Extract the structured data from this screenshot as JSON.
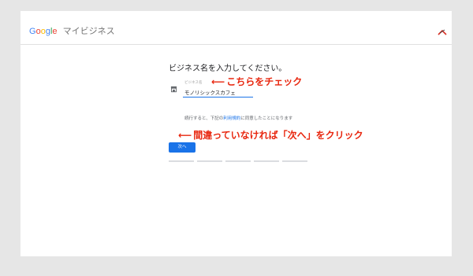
{
  "header": {
    "brand_google": "Google",
    "product": "マイビジネス"
  },
  "main": {
    "heading": "ビジネス名を入力してください。",
    "field": {
      "label": "ビジネス名",
      "value": "モノリシックスカフェ"
    },
    "terms": {
      "before": "続行すると、下記の",
      "link": "利用規約",
      "after": "に同意したことになります"
    },
    "next_label": "次へ",
    "progress_steps": 5
  },
  "annotations": {
    "callout1": "こちらをチェック",
    "callout2": "間違っていなければ「次へ」をクリック",
    "arrow": "⟵"
  },
  "colors": {
    "accent": "#1a73e8",
    "callout": "#e8260e",
    "frame": "#e6e6e6"
  }
}
